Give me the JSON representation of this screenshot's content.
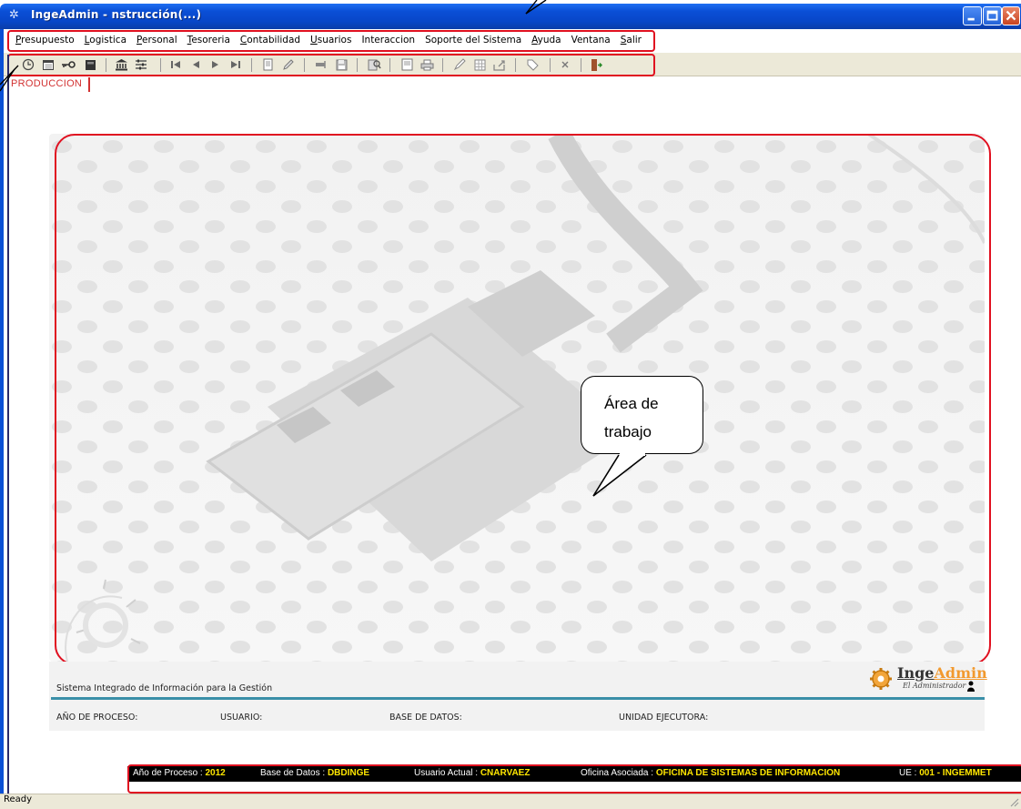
{
  "window": {
    "title": "IngeAdmin -  nstrucción(...)"
  },
  "menu": {
    "items": [
      {
        "accel": "P",
        "rest": "resupuesto"
      },
      {
        "accel": "L",
        "rest": "ogistica"
      },
      {
        "accel": "P",
        "rest": "ersonal",
        "prefix": ""
      },
      {
        "accel": "T",
        "rest": "esoreria"
      },
      {
        "accel": "C",
        "rest": "ontabilidad"
      },
      {
        "accel": "U",
        "rest": "suarios"
      },
      {
        "accel": "",
        "rest": "Interaccion"
      },
      {
        "accel": "",
        "rest": "Soporte del Sistema"
      },
      {
        "accel": "A",
        "rest": "yuda"
      },
      {
        "accel": "",
        "rest": "Ventana"
      },
      {
        "accel": "S",
        "rest": "alir"
      }
    ]
  },
  "tab": {
    "label": "PRODUCCION"
  },
  "bubble": {
    "line1": "Área de",
    "line2": "trabajo"
  },
  "panel": {
    "system_name": "Sistema Integrado de Información para la Gestión",
    "logo_a": "Inge",
    "logo_b": "Admin",
    "logo_sub": "El Administrador",
    "labels": {
      "year": "AÑO DE PROCESO:",
      "user": "USUARIO:",
      "db": "BASE DE DATOS:",
      "unit": "UNIDAD EJECUTORA:"
    }
  },
  "infobar": {
    "year_label": "Año de Proceso : ",
    "year_value": "2012",
    "db_label": "Base de Datos : ",
    "db_value": "DBDINGE",
    "user_label": "Usuario Actual : ",
    "user_value": "CNARVAEZ",
    "office_label": "Oficina Asociada : ",
    "office_value": "OFICINA DE SISTEMAS DE INFORMACION",
    "ue_label": "UE : ",
    "ue_value": "001 - INGEMMET"
  },
  "status": {
    "text": "Ready"
  },
  "colors": {
    "titlebar": "#0a4fd6",
    "annotation": "#e01020",
    "info_value": "#ffe600"
  }
}
